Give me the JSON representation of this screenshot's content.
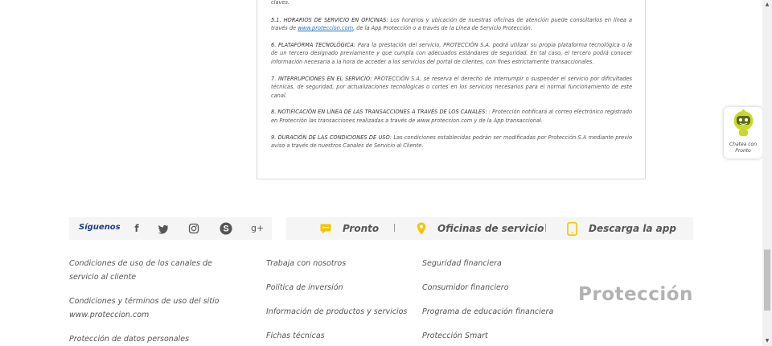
{
  "terms": {
    "top_fragment": "claves.",
    "s51_title": "5.1. HORARIOS DE SERVICIO EN OFICINAS:",
    "s51_text": " Los horarios y ubicación de nuestras oficinas de atención puede consultarlos en línea a través de ",
    "s51_link": "www.proteccion.com",
    "s51_text2": ", de la App Protección o a través de la Línea de Servicio Protección.",
    "s6_title": "6. PLATAFORMA TECNOLÓGICA:",
    "s6_text": " Para la prestación del servicio, PROTECCIÓN S.A. podrá utilizar su propia plataforma tecnológica o la de un tercero designado previamente y que cumpla con adecuados estándares de seguridad. En tal caso, el tercero podrá conocer información necesaria a la hora de acceder a los servicios del portal de clientes, con fines estrictamente transaccionales.",
    "s7_title": "7. INTERRUPCIONES EN EL SERVICIO:",
    "s7_text": " PROTECCIÓN S.A. se reserva el derecho de interrumpir o suspender el servicio por dificultades técnicas, de seguridad, por actualizaciones tecnológicas o cortes en los servicios necesarios para el normal funcionamiento de este canal.",
    "s8_title": "8. NOTIFICACIÓN EN LÍNEA DE LAS TRANSACCIONES A TRAVÉS DE LOS CANALES:",
    "s8_text": " : Protección notificará al correo electrónico registrado en Protección las transacciones realizadas a través de www.proteccion.com y de la App transaccional.",
    "s9_title": "9. DURACIÓN DE LAS CONDICIONES DE USO:",
    "s9_text": " Las condiciones establecidas podrán ser modificadas por Protección S.A mediante previo aviso a través de nuestros Canales de Servicio al Cliente."
  },
  "chat": {
    "label": "Chatea con Pronto"
  },
  "follow": {
    "label": "Síguenos",
    "icons": {
      "facebook": "f",
      "twitter": "🐦",
      "instagram": "◎",
      "skype": "S",
      "googleplus": "8+"
    }
  },
  "links_bar": {
    "pronto": "Pronto",
    "oficinas": "Oficinas de servicio",
    "app": "Descarga la app"
  },
  "footer": {
    "col1": [
      "Condiciones de uso de los canales de servicio al cliente",
      "Condiciones y términos de uso del sitio www.proteccion.com",
      "Protección de datos personales"
    ],
    "col2": [
      "Trabaja con nosotros",
      "Política de inversión",
      "Información de productos y servicios",
      "Fichas técnicas"
    ],
    "col3": [
      "Seguridad financiera",
      "Consumidor financiero",
      "Programa de educación financiera",
      "Protección Smart"
    ],
    "brand": "Protección"
  },
  "colors": {
    "accent_yellow": "#f5c400",
    "navy": "#1d3f7a"
  }
}
